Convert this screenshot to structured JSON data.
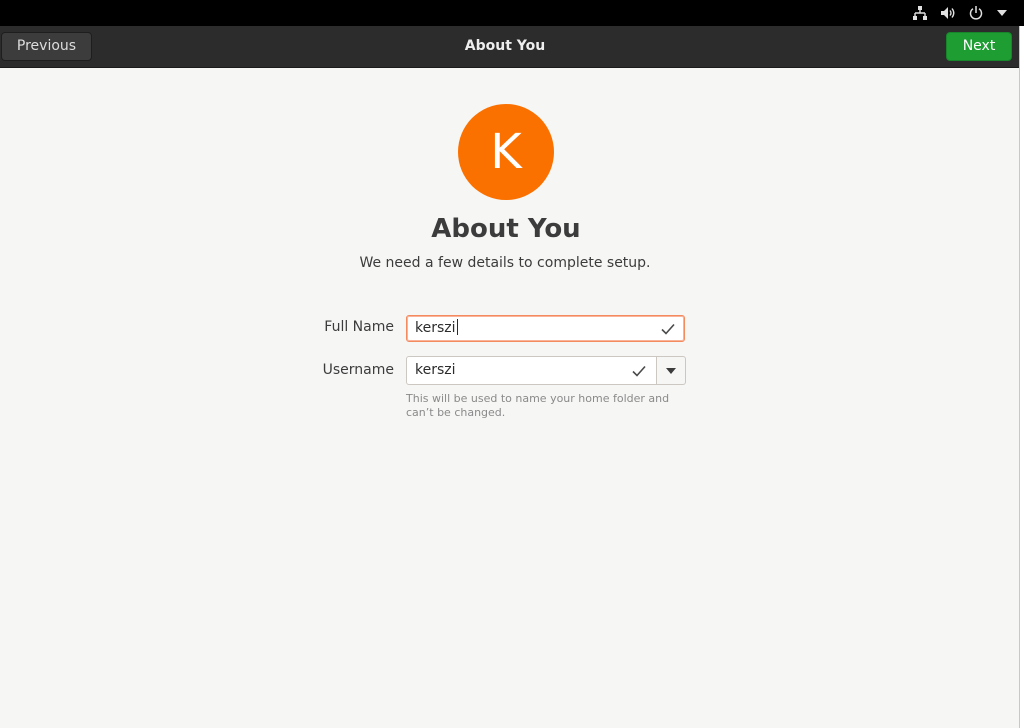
{
  "tray": {
    "icons": [
      "network-icon",
      "volume-icon",
      "power-icon",
      "menu-arrow-icon"
    ]
  },
  "header": {
    "previous_label": "Previous",
    "title": "About You",
    "next_label": "Next"
  },
  "avatar": {
    "initial": "K",
    "color": "#fb7100"
  },
  "main": {
    "title": "About You",
    "subtitle": "We need a few details to complete setup."
  },
  "form": {
    "full_name_label": "Full Name",
    "full_name_value": "kerszi",
    "username_label": "Username",
    "username_value": "kerszi",
    "username_hint": "This will be used to name your home folder and can’t be changed."
  },
  "colors": {
    "accent_next": "#1d9d32",
    "focus_ring": "#f38b5e",
    "avatar": "#fb7100"
  }
}
